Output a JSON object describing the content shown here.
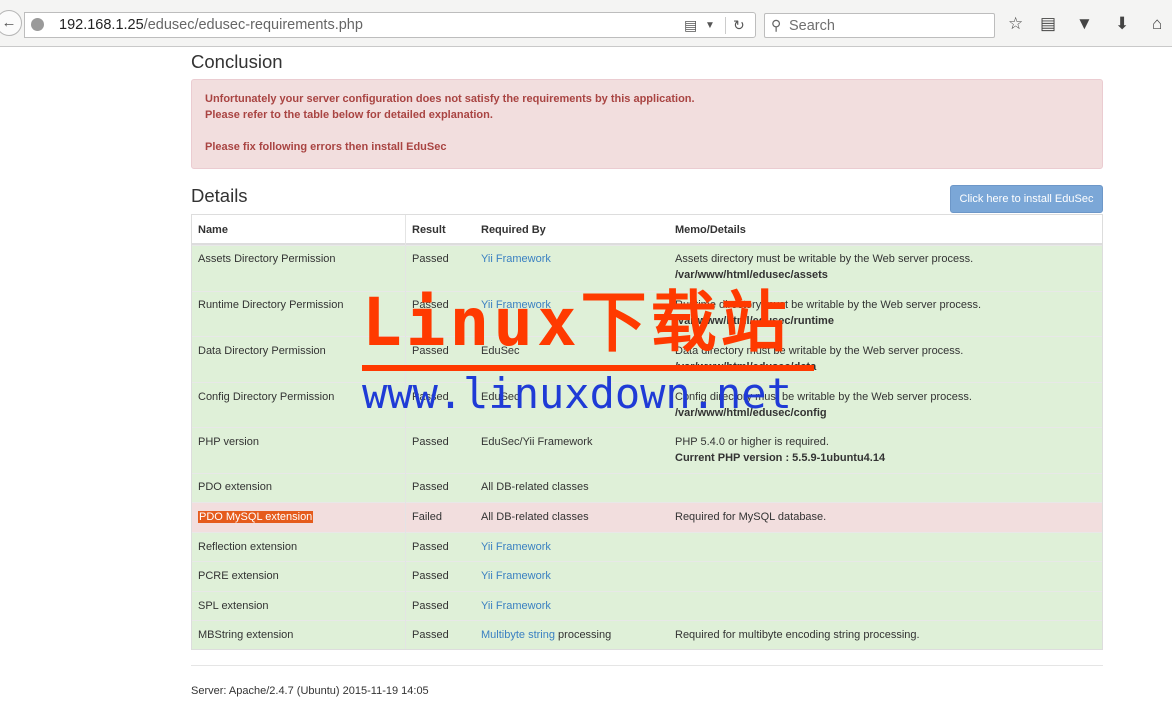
{
  "browser": {
    "url_host": "192.168.1.25",
    "url_path": "/edusec/edusec-requirements.php",
    "search_placeholder": "Search",
    "icons": [
      "back-arrow-icon",
      "globe-icon",
      "reader-view-icon",
      "dropdown-icon",
      "reload-icon",
      "search-icon",
      "bookmark-star-icon",
      "reading-list-icon",
      "pocket-icon",
      "download-icon",
      "home-icon"
    ]
  },
  "conclusion": {
    "title": "Conclusion",
    "line1": "Unfortunately your server configuration does not satisfy the requirements by this application.",
    "line2": "Please refer to the table below for detailed explanation.",
    "line3": "Please fix following errors then install EduSec"
  },
  "details": {
    "title": "Details",
    "install_button": "Click here to install EduSec",
    "columns": [
      "Name",
      "Result",
      "Required By",
      "Memo/Details"
    ],
    "rows": [
      {
        "name": "Assets Directory Permission",
        "result": "Passed",
        "required_by": "Yii Framework",
        "memo": "Assets directory must be writable by the Web server process.",
        "memo_bold": "/var/www/html/edusec/assets"
      },
      {
        "name": "Runtime Directory Permission",
        "result": "Passed",
        "required_by": "Yii Framework",
        "memo": "Runtime directory must be writable by the Web server process.",
        "memo_bold": "/var/www/html/edusec/runtime"
      },
      {
        "name": "Data Directory Permission",
        "result": "Passed",
        "required_by": "EduSec",
        "memo": "Data directory must be writable by the Web server process.",
        "memo_bold": "/var/www/html/edusec/data"
      },
      {
        "name": "Config Directory Permission",
        "result": "Passed",
        "required_by": "EduSec",
        "memo": "Config directory must be writable by the Web server process.",
        "memo_bold": "/var/www/html/edusec/config"
      },
      {
        "name": "PHP version",
        "result": "Passed",
        "required_by": "EduSec/Yii Framework",
        "memo": "PHP 5.4.0 or higher is required.",
        "memo_bold": "Current PHP version : 5.5.9-1ubuntu4.14"
      },
      {
        "name": "PDO extension",
        "result": "Passed",
        "required_by": "All DB-related classes",
        "memo": "",
        "memo_bold": ""
      },
      {
        "name": "PDO MySQL extension",
        "result": "Failed",
        "required_by": "All DB-related classes",
        "memo": "Required for MySQL database.",
        "memo_bold": ""
      },
      {
        "name": "Reflection extension",
        "result": "Passed",
        "required_by": "Yii Framework",
        "memo": "",
        "memo_bold": ""
      },
      {
        "name": "PCRE extension",
        "result": "Passed",
        "required_by": "Yii Framework",
        "memo": "",
        "memo_bold": ""
      },
      {
        "name": "SPL extension",
        "result": "Passed",
        "required_by": "Yii Framework",
        "memo": "",
        "memo_bold": ""
      },
      {
        "name": "MBString extension",
        "result": "Passed",
        "required_by": "Multibyte string",
        "required_by_suffix": " processing",
        "memo": "Required for multibyte encoding string processing.",
        "memo_bold": ""
      }
    ]
  },
  "footer": "Server: Apache/2.4.7 (Ubuntu) 2015-11-19 14:05",
  "watermark": {
    "line1": "Linux下载站",
    "line2": "www.linuxdown.net"
  },
  "colors": {
    "pass_row": "#dff0d8",
    "fail_row": "#f2dede",
    "alert_text": "#a94442",
    "link": "#3a80c2",
    "button": "#7ba7d7",
    "watermark_red": "#ff3a00",
    "watermark_blue": "#1f3bd6"
  }
}
